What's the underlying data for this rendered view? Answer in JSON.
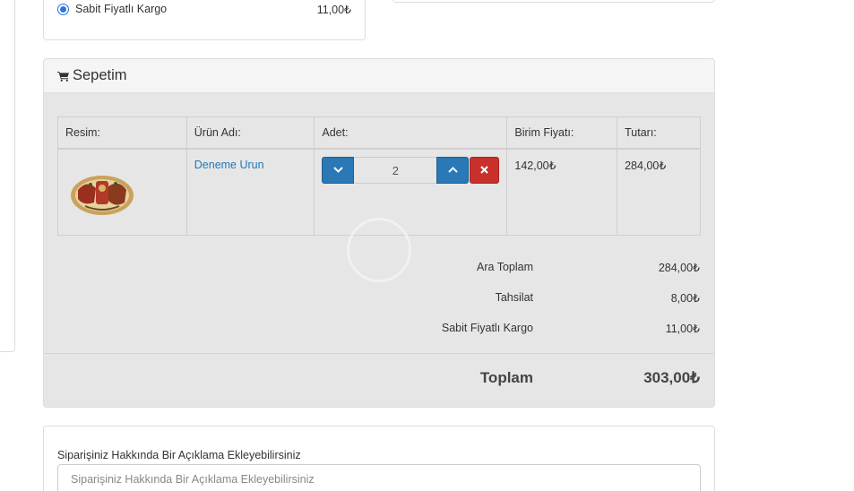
{
  "shipping": {
    "option_label": "Sabit Fiyatlı Kargo",
    "option_price": "11,00₺",
    "selected": true
  },
  "cart": {
    "title": "Sepetim",
    "icon": "shopping-cart-icon",
    "columns": [
      "Resim:",
      "Ürün Adı:",
      "Adet:",
      "Birim Fiyatı:",
      "Tutarı:"
    ],
    "items": [
      {
        "image_icon": "cigar-box-product-image",
        "name": "Deneme Urun",
        "quantity": "2",
        "unit_price": "142,00₺",
        "total": "284,00₺"
      }
    ]
  },
  "totals": {
    "subtotal_label": "Ara Toplam",
    "subtotal_value": "284,00₺",
    "fee_label": "Tahsilat",
    "fee_value": "8,00₺",
    "shipping_label": "Sabit Fiyatlı Kargo",
    "shipping_value": "11,00₺",
    "grand_label": "Toplam",
    "grand_value": "303,00₺"
  },
  "note": {
    "label": "Siparişiniz Hakkında Bir Açıklama Ekleyebilirsiniz",
    "placeholder": "Siparişiniz Hakkında Bir Açıklama Ekleyebilirsiniz",
    "value": ""
  },
  "colors": {
    "link": "#1f7ab8",
    "qty_button": "#2a78b5",
    "remove_button": "#c9302c",
    "panel_bg": "#e6e6e6"
  }
}
